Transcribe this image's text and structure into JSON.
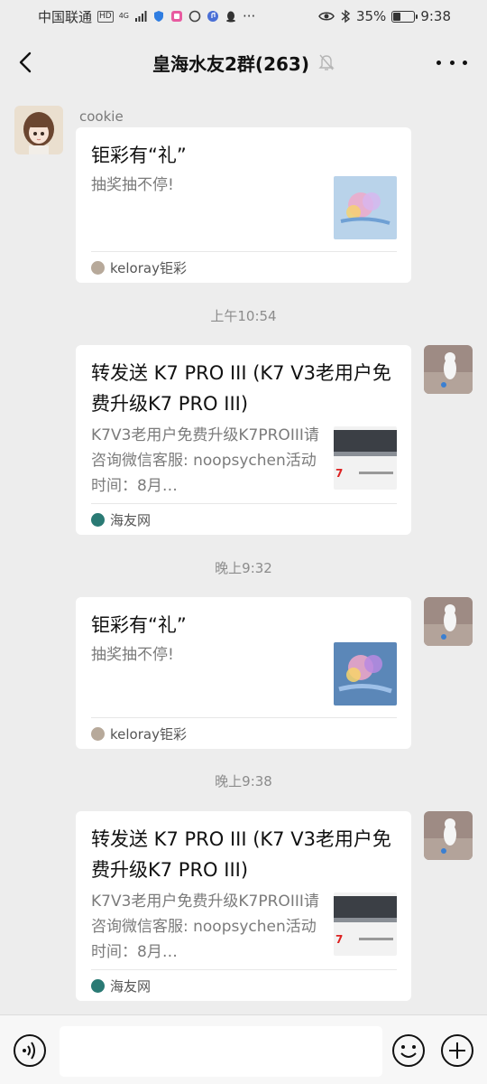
{
  "status_bar": {
    "carrier": "中国联通",
    "hd": "HD",
    "network": "4G",
    "battery_pct": "35%",
    "battery_level": 0.35,
    "time": "9:38"
  },
  "nav": {
    "title": "皇海水友2群(263)",
    "back_icon": "chevron-left-icon",
    "mute_icon": "bell-off-icon",
    "more_icon": "more-horizontal-icon"
  },
  "messages": [
    {
      "sender": "cookie",
      "title": "钜彩有“礼”",
      "desc": "抽奖抽不停!",
      "source": "keloray钜彩"
    },
    {
      "timestamp": "上午10:54",
      "title": "转发送 K7 PRO III (K7 V3老用户免费升级K7 PRO III)",
      "desc": "K7V3老用户免费升级K7PROIII请咨询微信客服: noopsychen活动时间：8月…",
      "source": "海友网"
    },
    {
      "timestamp": "晚上9:32",
      "title": "钜彩有“礼”",
      "desc": "抽奖抽不停!",
      "source": "keloray钜彩"
    },
    {
      "timestamp": "晚上9:38",
      "title": "转发送 K7 PRO III (K7 V3老用户免费升级K7 PRO III)",
      "desc": "K7V3老用户免费升级K7PROIII请咨询微信客服: noopsychen活动时间：8月…",
      "source": "海友网"
    }
  ],
  "input_bar": {
    "voice_icon": "voice-icon",
    "emoji_icon": "emoji-icon",
    "plus_icon": "plus-circle-icon",
    "placeholder": ""
  },
  "colors": {
    "background": "#ededed",
    "card": "#ffffff",
    "muted_text": "#7b7b7b"
  }
}
